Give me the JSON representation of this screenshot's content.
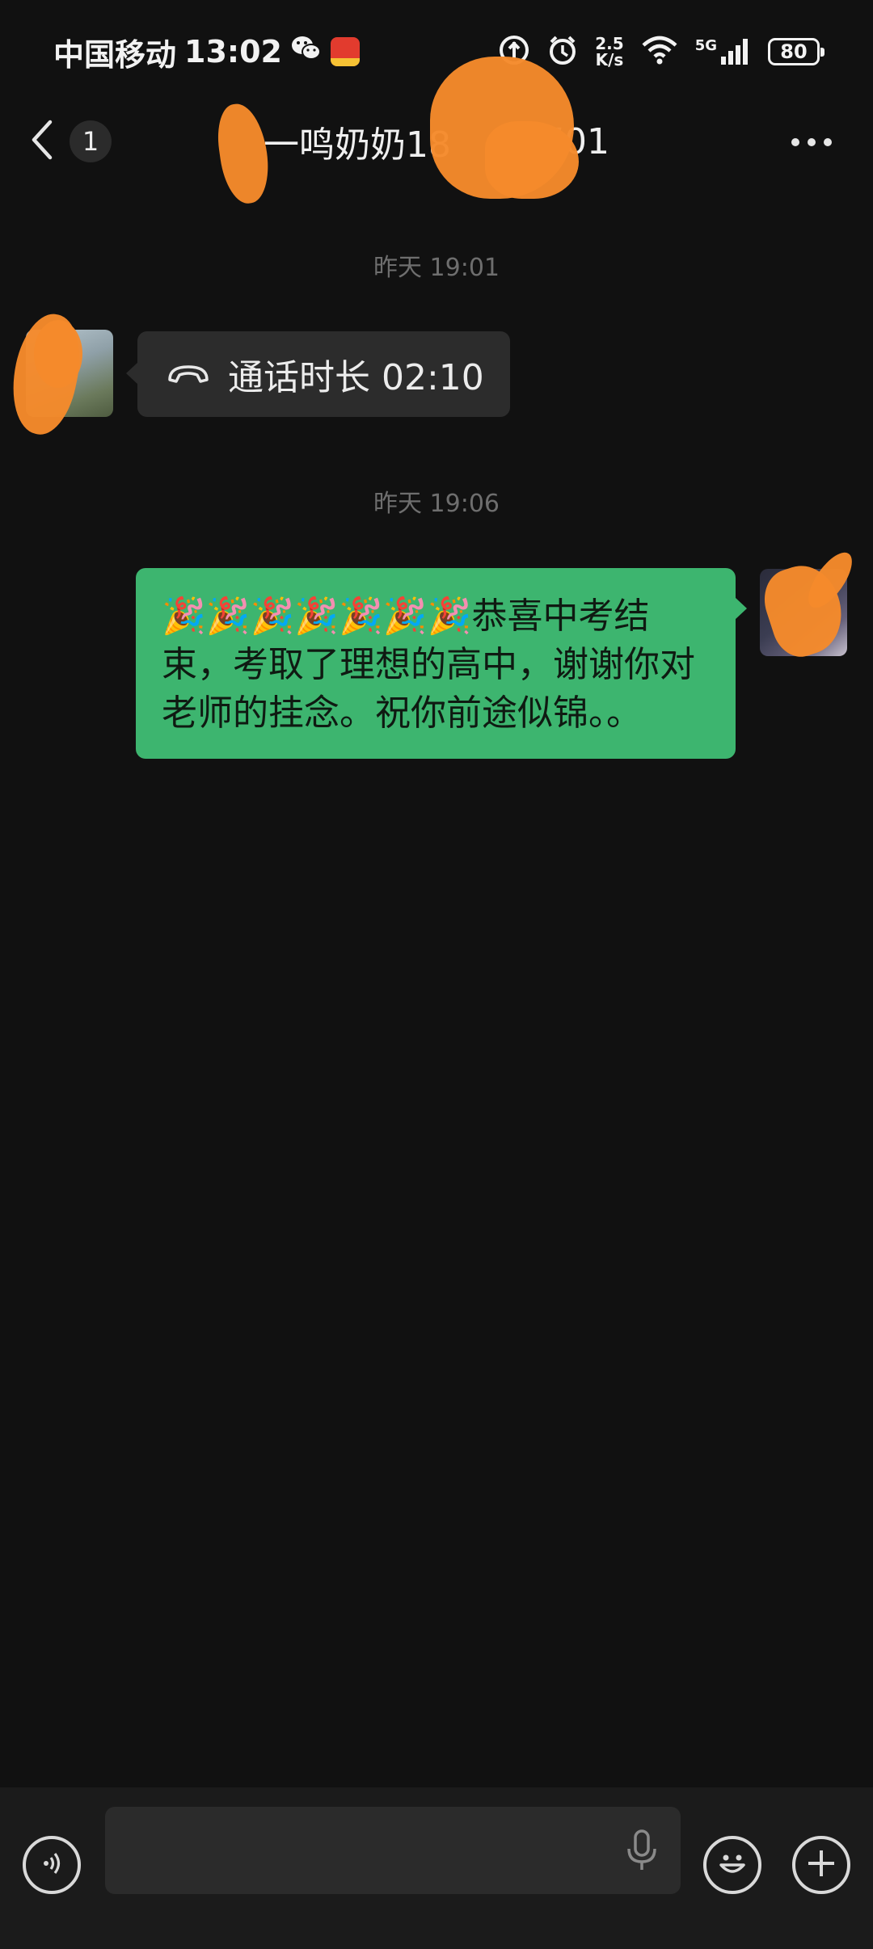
{
  "status_bar": {
    "carrier": "中国移动",
    "time": "13:02",
    "net_speed_value": "2.5",
    "net_speed_unit": "K/s",
    "network_type": "5G",
    "battery": "80"
  },
  "header": {
    "back_badge": "1",
    "title": "一鸣奶奶18",
    "title_suffix": "701"
  },
  "messages": [
    {
      "timestamp": "昨天 19:01",
      "sender": "contact",
      "type": "call",
      "text": "通话时长 02:10"
    },
    {
      "timestamp": "昨天 19:06",
      "sender": "self",
      "type": "text",
      "emoji": "🎉🎉🎉🎉🎉🎉🎉",
      "text": "恭喜中考结束，考取了理想的高中，谢谢你对老师的挂念。祝你前途似锦。。"
    }
  ],
  "input_bar": {
    "placeholder": ""
  },
  "colors": {
    "background": "#111111",
    "self_bubble": "#3db56f",
    "contact_bubble": "#2c2c2c",
    "redaction": "#f58a2b"
  }
}
